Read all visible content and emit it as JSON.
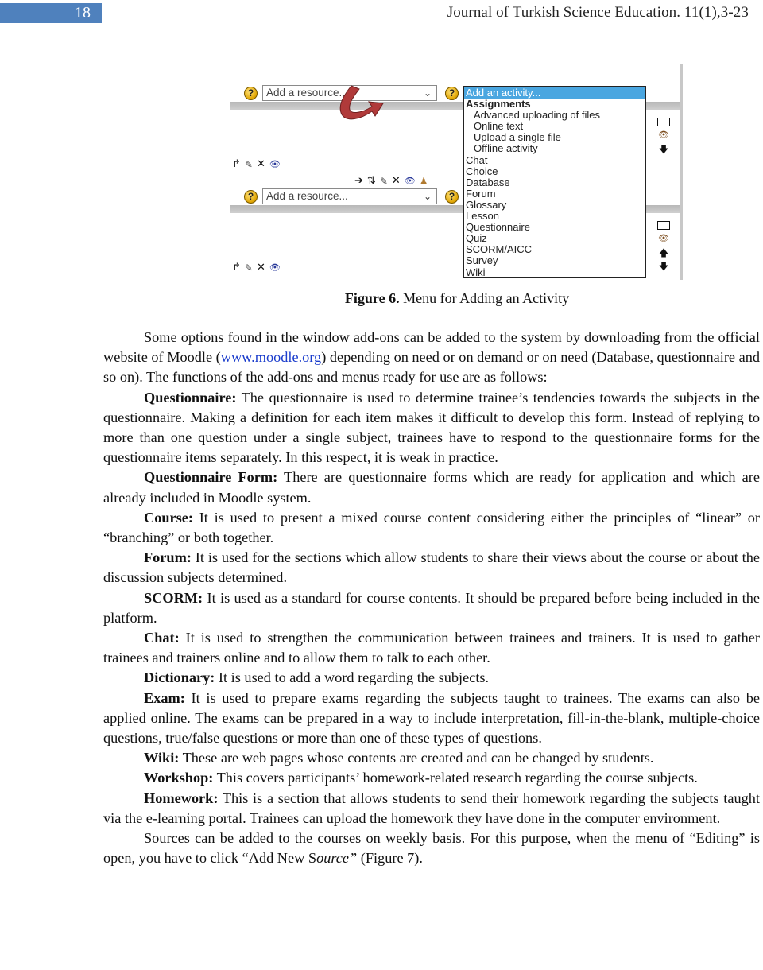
{
  "header": {
    "page_number": "18",
    "journal": "Journal of Turkish Science Education. 11(1),3-23",
    "page_number_bar_color": "#4f81bd"
  },
  "figure": {
    "resource_select_1": {
      "value": "Add a resource...",
      "chevron": "chevron-down-icon"
    },
    "resource_select_2": {
      "value": "Add a resource...",
      "chevron": "chevron-down-icon"
    },
    "help_glyph": "?",
    "activity_menu": {
      "selected": "Add an activity...",
      "options": [
        {
          "label": "Assignments",
          "kind": "group"
        },
        {
          "label": "Advanced uploading of files",
          "kind": "sub"
        },
        {
          "label": "Online text",
          "kind": "sub"
        },
        {
          "label": "Upload a single file",
          "kind": "sub"
        },
        {
          "label": "Offline activity",
          "kind": "sub"
        },
        {
          "label": "Chat",
          "kind": "item"
        },
        {
          "label": "Choice",
          "kind": "item"
        },
        {
          "label": "Database",
          "kind": "item"
        },
        {
          "label": "Forum",
          "kind": "item"
        },
        {
          "label": "Glossary",
          "kind": "item"
        },
        {
          "label": "Lesson",
          "kind": "item"
        },
        {
          "label": "Questionnaire",
          "kind": "item"
        },
        {
          "label": "Quiz",
          "kind": "item"
        },
        {
          "label": "SCORM/AICC",
          "kind": "item"
        },
        {
          "label": "Survey",
          "kind": "item"
        },
        {
          "label": "Wiki",
          "kind": "item"
        }
      ],
      "highlight_color": "#4aa6e0"
    },
    "edit_icons_short": [
      {
        "name": "move-icon",
        "glyph": "↱"
      },
      {
        "name": "edit-icon",
        "glyph": "✎"
      },
      {
        "name": "delete-icon",
        "glyph": "✕"
      },
      {
        "name": "visibility-eye-icon",
        "glyph": "👁"
      }
    ],
    "edit_icons_long": [
      {
        "name": "indent-right-arrow-icon",
        "glyph": "➔"
      },
      {
        "name": "move-updown-icon",
        "glyph": "⇅"
      },
      {
        "name": "edit-icon",
        "glyph": "✎"
      },
      {
        "name": "delete-icon",
        "glyph": "✕"
      },
      {
        "name": "visibility-eye-icon",
        "glyph": "👁"
      },
      {
        "name": "group-mode-person-icon",
        "glyph": "♟"
      }
    ],
    "side_icons": {
      "box": "□",
      "eye": "👁",
      "up": "🡅",
      "down": "🡇"
    },
    "arrow_color": "#b03a3a",
    "caption_label": "Figure 6.",
    "caption_text": " Menu for Adding an Activity"
  },
  "body": {
    "intro": {
      "p1_before": "Some options found in the window add-ons can be added to the system by downloading from the official website of Moodle (",
      "link": "www.moodle.org",
      "p1_after": ") depending on need or on demand or on need (Database, questionnaire and so on). The functions of the add-ons and menus ready for use are as follows:"
    },
    "definitions": [
      {
        "term": "Questionnaire:",
        "text": " The questionnaire is used to determine trainee’s tendencies towards the subjects in the questionnaire. Making a definition for each item makes it difficult to develop this form. Instead of replying to more than one question under a single subject, trainees have to respond to the questionnaire forms for the questionnaire items separately. In this respect, it is weak in practice."
      },
      {
        "term": "Questionnaire Form:",
        "text": " There are questionnaire forms which are ready for application and which are already included in Moodle system."
      },
      {
        "term": "Course:",
        "text": " It is used to present a mixed course content considering either the principles of “linear” or “branching” or both together."
      },
      {
        "term": "Forum:",
        "text": " It is used for the sections which allow students to share their views about the course or about the discussion subjects determined."
      },
      {
        "term": "SCORM:",
        "text": " It is used as a standard for course contents. It should be prepared before being included in the platform."
      },
      {
        "term": "Chat:",
        "text": " It is used to strengthen the communication between trainees and trainers. It is used to gather trainees and trainers online and to allow them to talk to each other."
      },
      {
        "term": "Dictionary:",
        "text": " It is used to add a word regarding the subjects."
      },
      {
        "term": "Exam:",
        "text": " It is used to prepare exams regarding the subjects taught to trainees. The exams can also be applied online. The exams can be prepared in a way to include interpretation, fill-in-the-blank, multiple-choice questions, true/false questions or more than one of these types of questions."
      },
      {
        "term": "Wiki:",
        "text": " These are web pages whose contents are created and can be changed by students."
      },
      {
        "term": "Workshop:",
        "text": " This covers participants’ homework-related research regarding the course subjects."
      },
      {
        "term": "Homework:",
        "text": " This is a section that allows students to send their homework regarding the subjects taught via the e-learning portal. Trainees can upload the homework they have done in the computer environment."
      }
    ],
    "closing": {
      "before": "Sources can be added to the courses on weekly basis. For this purpose, when the menu of “Editing” is open, you have to click “Add New S",
      "italic": "ource”",
      "after": " (Figure 7)."
    },
    "link_color": "#1a3ccc"
  }
}
